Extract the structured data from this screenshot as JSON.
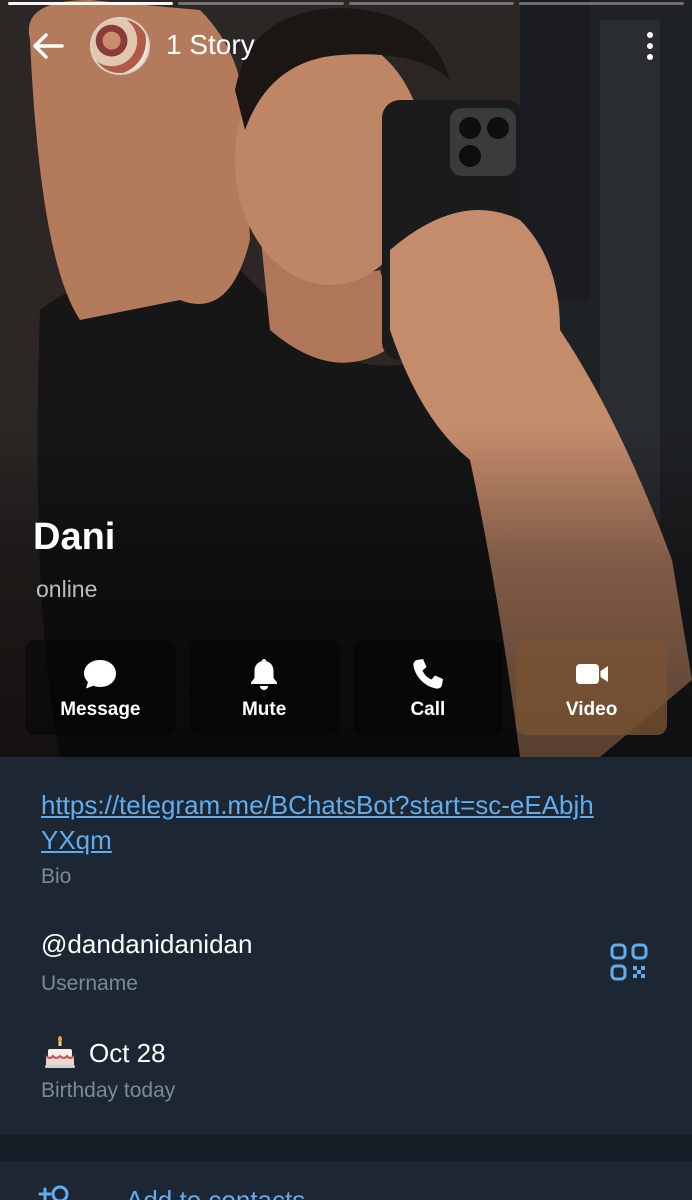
{
  "header": {
    "story_count_label": "1 Story",
    "story_segments": [
      true,
      false,
      false,
      false
    ]
  },
  "profile": {
    "name": "Dani",
    "status": "online"
  },
  "actions": [
    {
      "label": "Message",
      "icon": "chat-bubble-icon"
    },
    {
      "label": "Mute",
      "icon": "bell-icon"
    },
    {
      "label": "Call",
      "icon": "phone-icon"
    },
    {
      "label": "Video",
      "icon": "video-camera-icon"
    }
  ],
  "info": {
    "bio_link": "https://telegram.me/BChatsBot?start=sc-eEAbjhYXqm",
    "bio_caption": "Bio",
    "username": "@dandanidanidan",
    "username_caption": "Username",
    "birthday": "Oct 28",
    "birthday_caption": "Birthday today"
  },
  "contacts": {
    "add_label": "Add to contacts"
  },
  "colors": {
    "link": "#62acee",
    "panel_bg": "#1d2733",
    "caption": "#7b8a98"
  }
}
